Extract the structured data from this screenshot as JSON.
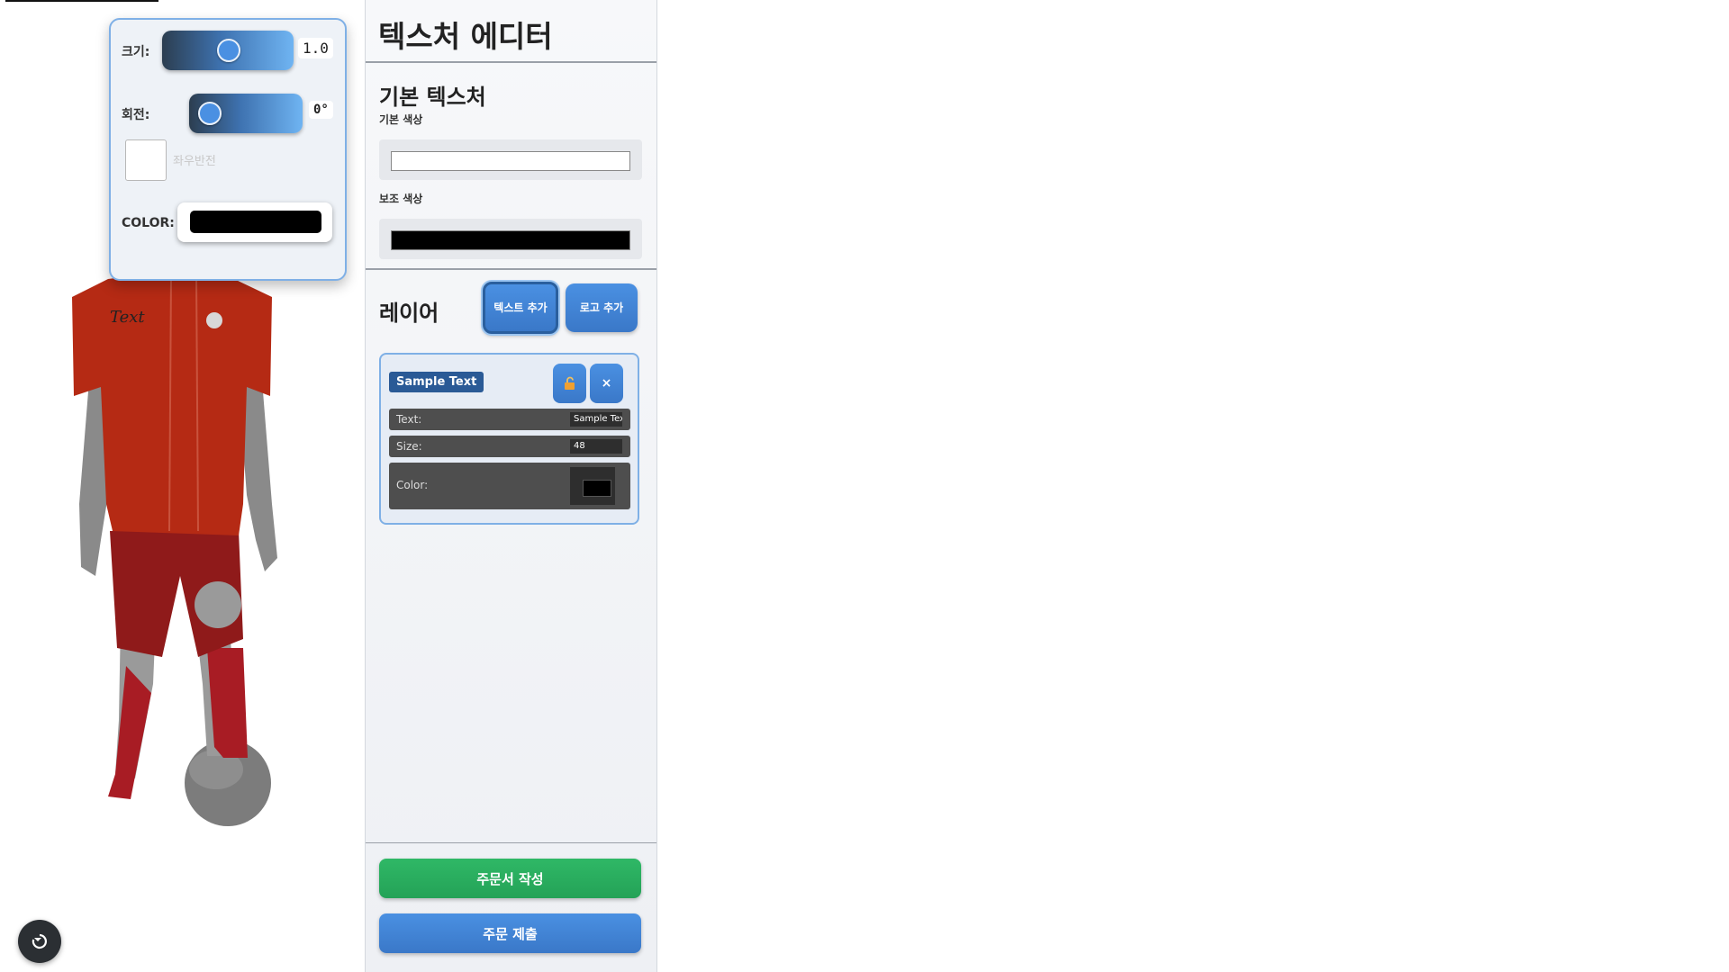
{
  "viewport": {
    "controls": {
      "scale_label": "크기:",
      "scale_value": "1.0",
      "scale_level": 0.5,
      "rotation_label": "회전:",
      "rotation_value": "0°",
      "rotation_level": 0.0,
      "swatch_label": "좌우반전",
      "color_label": "COLOR:",
      "color_value": "#000000"
    },
    "model": {
      "jersey_color": "#b52a14",
      "shorts_color": "#8f1a1a",
      "socks_color": "#a81c24",
      "jersey_print": "Text"
    },
    "reset_icon": "reset-icon"
  },
  "editor": {
    "title": "텍스처 에디터",
    "base_section": {
      "title": "기본 텍스처",
      "primary_label": "기본 색상",
      "primary_color": "#ffffff",
      "secondary_label": "보조 색상",
      "secondary_color": "#000000"
    },
    "layers_section": {
      "title": "레이어",
      "add_text_button": "텍스트 추가",
      "add_logo_button": "로고 추가",
      "layers": [
        {
          "name": "Sample Text",
          "lock_icon": "lock-icon",
          "delete_label": "×",
          "text_label": "Text:",
          "text_value": "Sample Text",
          "size_label": "Size:",
          "size_value": "48",
          "color_label": "Color:",
          "color_value": "#000000"
        }
      ]
    },
    "order_button": "주문서 작성",
    "submit_button": "주문 제출"
  }
}
